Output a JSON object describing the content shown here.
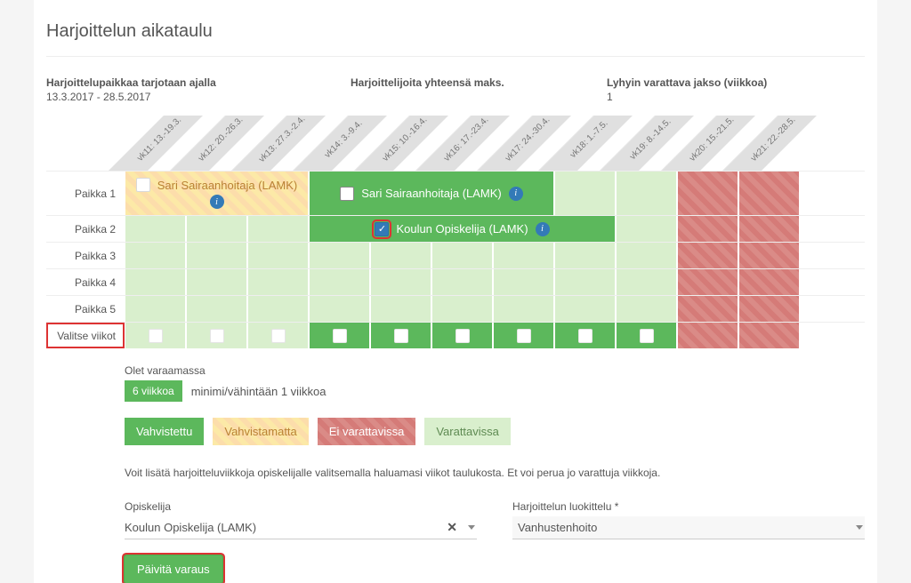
{
  "title": "Harjoittelun aikataulu",
  "meta": {
    "offered_label": "Harjoittelupaikkaa tarjotaan ajalla",
    "offered_value": "13.3.2017 - 28.5.2017",
    "trainees_label": "Harjoittelijoita yhteensä maks.",
    "min_label": "Lyhyin varattava jakso (viikkoa)",
    "min_value": "1"
  },
  "weeks": [
    "vk11: 13.-19.3.",
    "vk12: 20.-26.3.",
    "vk13: 27.3.-2.4.",
    "vk14: 3.-9.4.",
    "vk15: 10.-16.4.",
    "vk16: 17.-23.4.",
    "vk17: 24.-30.4.",
    "vk18: 1.-7.5.",
    "vk19: 8.-14.5.",
    "vk20: 15.-21.5.",
    "vk21: 22.-28.5."
  ],
  "rows": {
    "r1": "Paikka 1",
    "r2": "Paikka 2",
    "r3": "Paikka 3",
    "r4": "Paikka 4",
    "r5": "Paikka 5",
    "select": "Valitse viikot"
  },
  "assignees": {
    "a1": "Sari Sairaanhoitaja (LAMK)",
    "a2": "Sari Sairaanhoitaja (LAMK)",
    "a3": "Koulun Opiskelija (LAMK)"
  },
  "lower": {
    "reserving_label": "Olet varaamassa",
    "weeks_count": "6 viikkoa",
    "min_text": "minimi/vähintään 1 viikkoa",
    "legend_confirmed": "Vahvistettu",
    "legend_unconfirmed": "Vahvistamatta",
    "legend_unavailable": "Ei varattavissa",
    "legend_available": "Varattavissa",
    "help": "Voit lisätä harjoitteluviikkoja opiskelijalle valitsemalla haluamasi viikot taulukosta. Et voi perua jo varattuja viikkoja."
  },
  "form": {
    "student_label": "Opiskelija",
    "student_value": "Koulun Opiskelija (LAMK)",
    "category_label": "Harjoittelun luokittelu *",
    "category_value": "Vanhustenhoito",
    "update_button": "Päivitä varaus"
  }
}
